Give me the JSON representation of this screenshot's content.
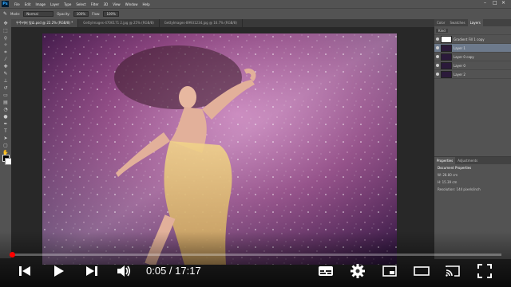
{
  "menubar": {
    "logo": "Ps",
    "items": [
      "File",
      "Edit",
      "Image",
      "Layer",
      "Type",
      "Select",
      "Filter",
      "3D",
      "View",
      "Window",
      "Help"
    ]
  },
  "options": {
    "mode_label": "Mode:",
    "mode_value": "Normal",
    "opacity_label": "Opacity:",
    "opacity_value": "100%",
    "flow_label": "Flow:",
    "flow_value": "100%"
  },
  "tabs": [
    {
      "label": "우주커버 빛효.psd @ 22.2% (RGB/8) *"
    },
    {
      "label": "GettyImages-4706171 2.jpg @ 25% (RGB/8)"
    },
    {
      "label": "GettyImages-89931234.jpg @ 16.7% (RGB/8)"
    }
  ],
  "panels": {
    "top_tabs": [
      "Color",
      "Swatches",
      "Layers"
    ],
    "kind_label": "Kind",
    "layers": [
      {
        "name": "Gradient Fill 1 copy"
      },
      {
        "name": "Layer 1"
      },
      {
        "name": "Layer 0 copy"
      },
      {
        "name": "Layer 0"
      },
      {
        "name": "Layer 2"
      }
    ],
    "props_tabs": [
      "Properties",
      "Adjustments"
    ],
    "props_title": "Document Properties",
    "props_w": "W: 28.80 cm",
    "props_h": "H: 15.39 cm",
    "props_res": "Resolution: 144 pixels/inch"
  },
  "player": {
    "time_current": "0:05",
    "time_total": "17:17",
    "time_display": "0:05 / 17:17",
    "progress": 0.005
  },
  "colors": {
    "accent": "#ff0000",
    "ps_bg": "#535353"
  }
}
